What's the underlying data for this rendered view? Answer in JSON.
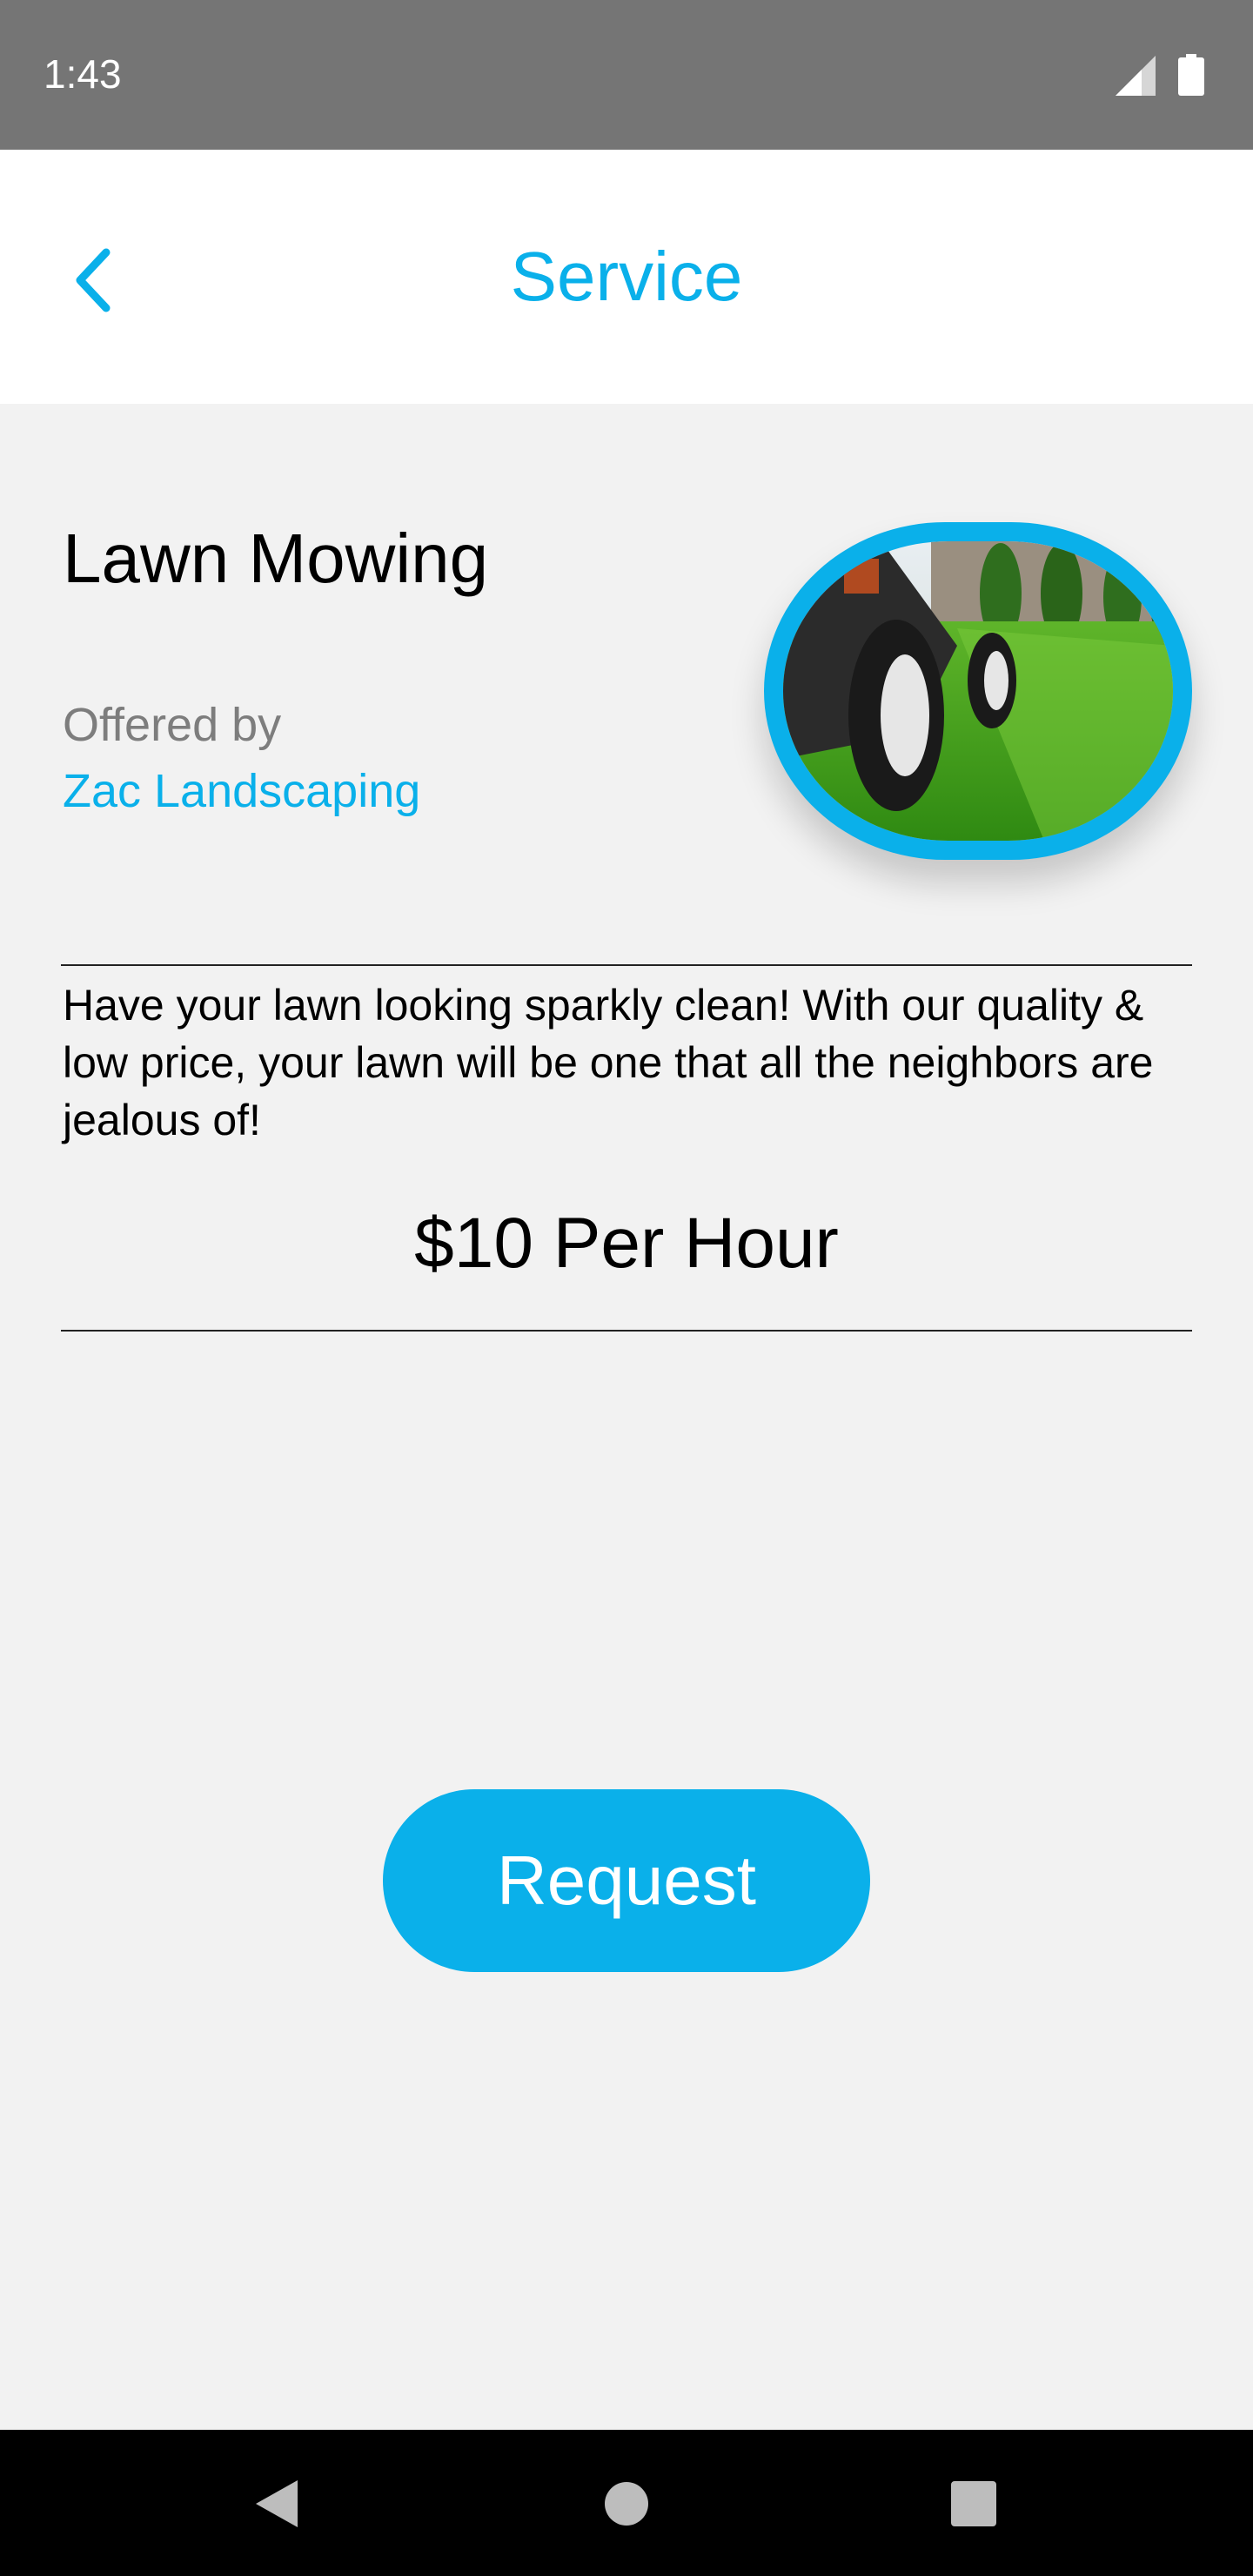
{
  "status_bar": {
    "time": "1:43",
    "icons": [
      "signal-icon",
      "battery-icon"
    ]
  },
  "app_bar": {
    "title": "Service",
    "back_icon": "chevron-left-icon",
    "accent": "#0ab0ea"
  },
  "service": {
    "name": "Lawn Mowing",
    "offered_label": "Offered by",
    "provider": "Zac Landscaping",
    "image": "lawn-mower-photo",
    "description": "Have your lawn looking sparkly clean! With our quality & low price, your lawn will be one that all the neighbors are jealous of!",
    "price": "$10 Per Hour"
  },
  "actions": {
    "request_label": "Request"
  },
  "nav_bar": {
    "buttons": [
      "back-triangle-icon",
      "home-circle-icon",
      "recents-square-icon"
    ]
  }
}
